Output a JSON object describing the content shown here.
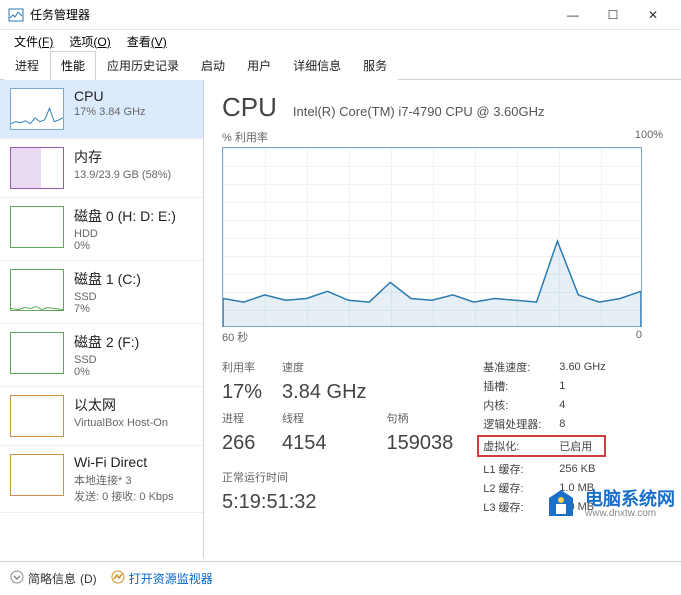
{
  "window": {
    "title": "任务管理器",
    "min": "—",
    "max": "☐",
    "close": "✕"
  },
  "menubar": {
    "file": "文件",
    "file_key": "(F)",
    "options": "选项",
    "options_key": "(O)",
    "view": "查看",
    "view_key": "(V)"
  },
  "tabs": {
    "t0": "进程",
    "t1": "性能",
    "t2": "应用历史记录",
    "t3": "启动",
    "t4": "用户",
    "t5": "详细信息",
    "t6": "服务"
  },
  "sidebar": [
    {
      "name": "CPU",
      "sub": "17% 3.84 GHz",
      "kind": "cpu"
    },
    {
      "name": "内存",
      "sub": "13.9/23.9 GB (58%)",
      "kind": "mem"
    },
    {
      "name": "磁盘 0 (H: D: E:)",
      "sub": "HDD",
      "sub2": "0%",
      "kind": "disk-g"
    },
    {
      "name": "磁盘 1 (C:)",
      "sub": "SSD",
      "sub2": "7%",
      "kind": "disk-g"
    },
    {
      "name": "磁盘 2 (F:)",
      "sub": "SSD",
      "sub2": "0%",
      "kind": "disk-g"
    },
    {
      "name": "以太网",
      "sub": "VirtualBox Host-On",
      "kind": "net"
    },
    {
      "name": "Wi-Fi Direct",
      "sub": "本地连接* 3",
      "sub2": "发送: 0 接收: 0 Kbps",
      "kind": "net"
    }
  ],
  "main": {
    "title": "CPU",
    "model": "Intel(R) Core(TM) i7-4790 CPU @ 3.60GHz",
    "chart": {
      "ylabel": "% 利用率",
      "ymax": "100%",
      "xlabel_left": "60 秒",
      "xlabel_right": "0"
    },
    "stats_left": {
      "util_lbl": "利用率",
      "util_val": "17%",
      "speed_lbl": "速度",
      "speed_val": "3.84 GHz",
      "proc_lbl": "进程",
      "proc_val": "266",
      "threads_lbl": "线程",
      "threads_val": "4154",
      "handles_lbl": "句柄",
      "handles_val": "159038",
      "uptime_lbl": "正常运行时间",
      "uptime_val": "5:19:51:32"
    },
    "stats_right": {
      "base_k": "基准速度:",
      "base_v": "3.60 GHz",
      "sockets_k": "插槽:",
      "sockets_v": "1",
      "cores_k": "内核:",
      "cores_v": "4",
      "lprocs_k": "逻辑处理器:",
      "lprocs_v": "8",
      "virt_k": "虚拟化:",
      "virt_v": "已启用",
      "l1_k": "L1 缓存:",
      "l1_v": "256 KB",
      "l2_k": "L2 缓存:",
      "l2_v": "1.0 MB",
      "l3_k": "L3 缓存:",
      "l3_v": "8.0 MB"
    }
  },
  "footer": {
    "fewer": "简略信息",
    "fewer_key": "(D)",
    "resmon": "打开资源监视器"
  },
  "watermark": {
    "cn": "电脑系统网",
    "url": "www.dnxtw.com"
  },
  "chart_data": {
    "type": "line",
    "title": "CPU % 利用率",
    "xlabel": "60 秒 → 0",
    "ylabel": "% 利用率",
    "ylim": [
      0,
      100
    ],
    "x_seconds_ago": [
      60,
      57,
      54,
      51,
      48,
      45,
      42,
      39,
      36,
      33,
      30,
      27,
      24,
      21,
      18,
      15,
      12,
      9,
      6,
      3,
      0
    ],
    "values": [
      16,
      14,
      18,
      15,
      16,
      20,
      15,
      14,
      25,
      16,
      15,
      18,
      14,
      16,
      15,
      14,
      48,
      18,
      14,
      16,
      20
    ]
  }
}
